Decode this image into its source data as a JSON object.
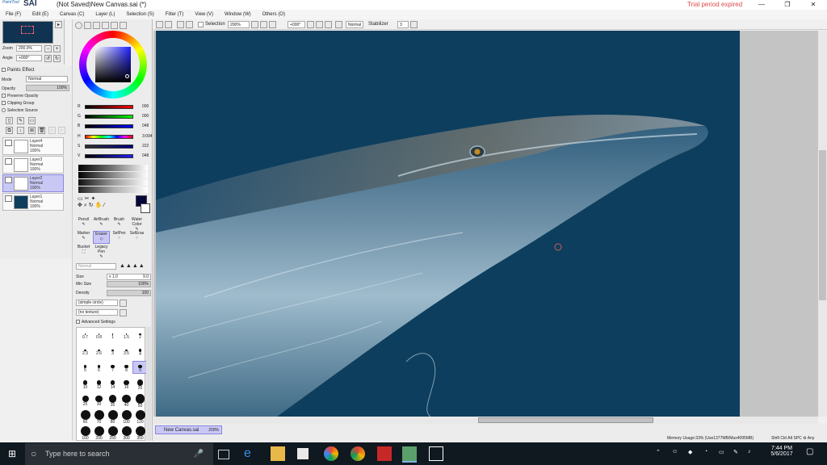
{
  "app": {
    "logo_small": "PaintTool",
    "logo_big": "SAI",
    "doc_title": "(Not Saved)New Canvas.sai (*)",
    "trial_notice": "Trial period expired",
    "window_controls": [
      "—",
      "❐",
      "✕"
    ]
  },
  "menu": [
    "File (F)",
    "Edit (E)",
    "Canvas (C)",
    "Layer (L)",
    "Selection (S)",
    "Filter (T)",
    "View (V)",
    "Window (W)",
    "Others (O)"
  ],
  "navigator": {
    "zoom_label": "Zoom",
    "zoom_value": "200.0%",
    "angle_label": "Angle",
    "angle_value": "+000°"
  },
  "layers_panel": {
    "paints_effect": "Paints Effect",
    "mode_label": "Mode",
    "mode_value": "Normal",
    "opacity_label": "Opacity",
    "opacity_value": "100%",
    "preserve_opacity": "Preserve Opacity",
    "clipping_group": "Clipping Group",
    "selection_source": "Selection Source",
    "layers": [
      {
        "name": "Layer4",
        "mode": "Normal",
        "opacity": "100%"
      },
      {
        "name": "Layer3",
        "mode": "Normal",
        "opacity": "100%"
      },
      {
        "name": "Layer2",
        "mode": "Normal",
        "opacity": "100%"
      },
      {
        "name": "Layer1",
        "mode": "Normal",
        "opacity": "100%"
      }
    ]
  },
  "color": {
    "sliders": [
      {
        "label": "R",
        "value": "000"
      },
      {
        "label": "G",
        "value": "000"
      },
      {
        "label": "B",
        "value": "048"
      },
      {
        "label": "H",
        "value": "3:094"
      },
      {
        "label": "S",
        "value": "222"
      },
      {
        "label": "V",
        "value": "048"
      }
    ],
    "current_color": "#06063a"
  },
  "tools": {
    "row1": [
      "Pencil",
      "AirBrush",
      "Brush",
      "Water Color"
    ],
    "row2": [
      "Marker",
      "Eraser",
      "SelPen",
      "SelEras"
    ],
    "row3": [
      "Bucket",
      "Legacy Pen"
    ],
    "active_tool": "Eraser",
    "blend_mode": "Normal",
    "size_label": "Size",
    "size_multiplier": "x 1.0",
    "size_value": "9.0",
    "min_size_label": "Min Size",
    "min_size_value": "100%",
    "density_label": "Density",
    "density_value": "100",
    "shape": "(simple circle)",
    "texture": "(no texture)",
    "advanced": "Advanced Settings",
    "brush_sizes": [
      "0.7",
      "0.8",
      "1",
      "1.5",
      "2",
      "2.3",
      "2.6",
      "3",
      "3.5",
      "4",
      "5",
      "6",
      "7",
      "8",
      "9",
      "10",
      "12",
      "14",
      "16",
      "20",
      "25",
      "30",
      "35",
      "40",
      "50",
      "60",
      "70",
      "80",
      "100",
      "120",
      "160",
      "200",
      "250",
      "300",
      "350"
    ]
  },
  "canvas_toolbar": {
    "selection_label": "Selection",
    "zoom": "200%",
    "angle": "+000°",
    "mode": "Normal",
    "stabilizer_label": "Stabilizer",
    "stabilizer_value": "3"
  },
  "document_tab": {
    "name": "New Canvas.sai",
    "zoom": "200%"
  },
  "status": {
    "memory": "Memory Usage:33% (Use1377MB/Max4095MB)",
    "keys": "Shift Ctrl Alt SPC ⚙ Any"
  },
  "taskbar": {
    "search_placeholder": "Type here to search",
    "time": "7:44 PM",
    "date": "5/6/2017"
  }
}
